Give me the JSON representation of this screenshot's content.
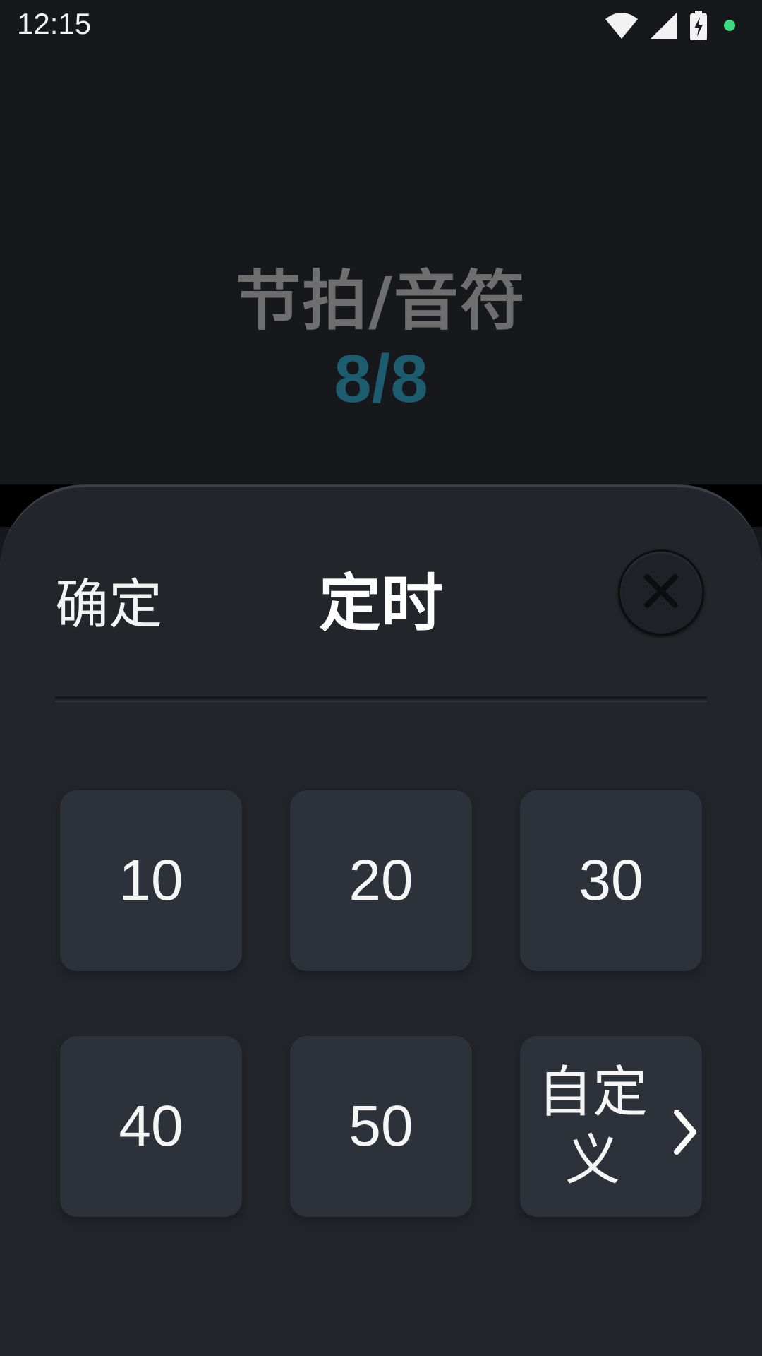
{
  "status_bar": {
    "time": "12:15",
    "icons": [
      "wifi-icon",
      "signal-icon",
      "battery-charging-icon",
      "notification-dot"
    ],
    "dot_color": "#3ddc84"
  },
  "background": {
    "title": "节拍/音符",
    "value": "8/8",
    "value_color": "#1d5b6e"
  },
  "sheet": {
    "confirm_label": "确定",
    "title": "定时",
    "close_icon": "close-icon",
    "options": [
      {
        "label": "10"
      },
      {
        "label": "20"
      },
      {
        "label": "30"
      },
      {
        "label": "40"
      },
      {
        "label": "50"
      },
      {
        "label": "自定义",
        "icon": "chevron-right-icon"
      }
    ]
  }
}
